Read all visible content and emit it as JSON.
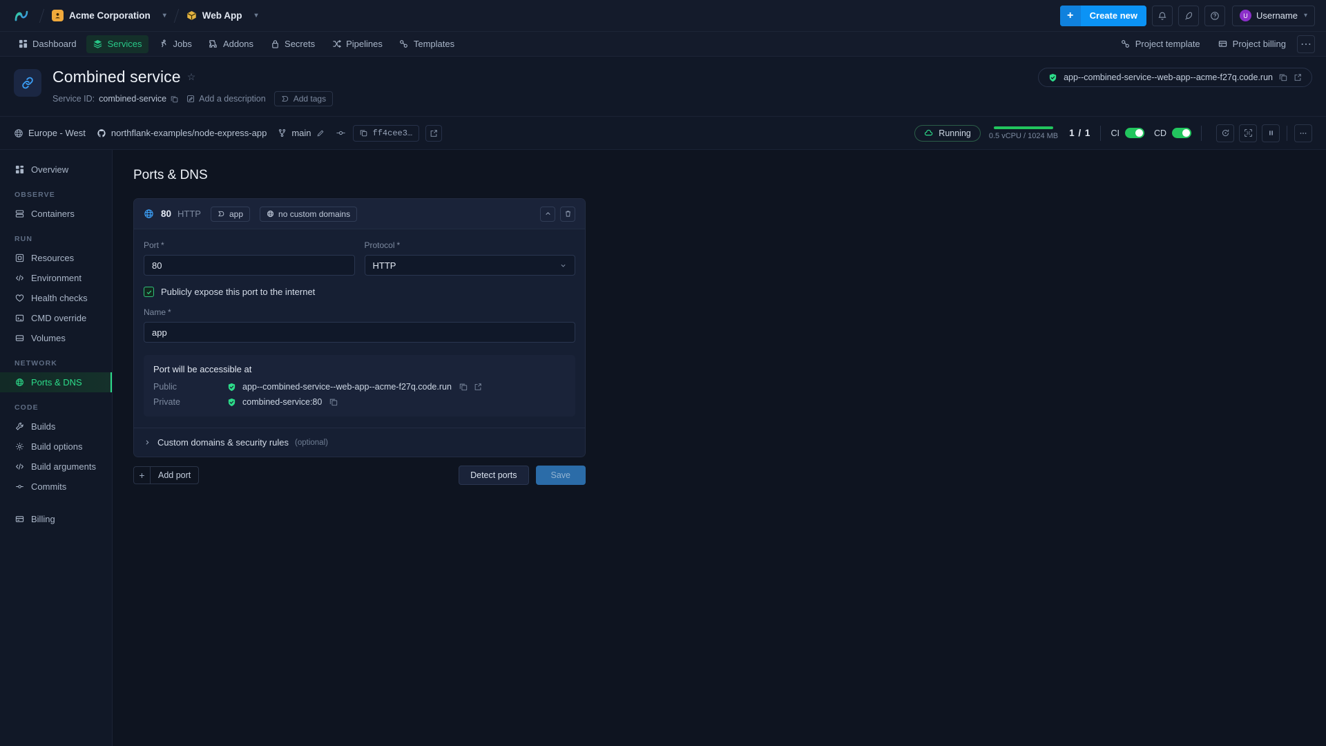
{
  "topbar": {
    "logo_icon": "northflank-logo-icon",
    "org": {
      "name": "Acme Corporation",
      "icon": "org-avatar-icon"
    },
    "project": {
      "name": "Web App",
      "icon": "project-cube-icon"
    },
    "create_new": {
      "label": "Create new",
      "plus": "+"
    },
    "icons": {
      "bell": "bell-icon",
      "rocket": "rocket-icon",
      "help": "help-circle-icon"
    },
    "user": {
      "name": "Username",
      "initial": "U"
    }
  },
  "nav": {
    "tabs": [
      {
        "label": "Dashboard",
        "icon": "grid-icon",
        "active": false
      },
      {
        "label": "Services",
        "icon": "layers-icon",
        "active": true
      },
      {
        "label": "Jobs",
        "icon": "runner-icon",
        "active": false
      },
      {
        "label": "Addons",
        "icon": "puzzle-icon",
        "active": false
      },
      {
        "label": "Secrets",
        "icon": "lock-icon",
        "active": false
      },
      {
        "label": "Pipelines",
        "icon": "shuffle-icon",
        "active": false
      },
      {
        "label": "Templates",
        "icon": "template-icon",
        "active": false
      }
    ],
    "right": [
      {
        "label": "Project template",
        "icon": "template-icon"
      },
      {
        "label": "Project billing",
        "icon": "billing-card-icon"
      }
    ],
    "more_label": "⋯"
  },
  "service": {
    "icon": "link-chain-icon",
    "title": "Combined service",
    "star_icon": "star-outline-icon",
    "id_label": "Service ID:",
    "id_value": "combined-service",
    "copy_icon": "copy-icon",
    "description_placeholder": "Add a description",
    "description_icon": "pencil-edit-icon",
    "tags_label": "Add tags",
    "tags_icon": "tag-icon",
    "url_pill": {
      "text": "app--combined-service--web-app--acme-f27q.code.run",
      "shield_icon": "shield-check-icon",
      "copy_icon": "copy-icon",
      "external_icon": "external-link-icon"
    }
  },
  "infobar": {
    "region": {
      "label": "Europe - West",
      "icon": "globe-icon"
    },
    "repo": {
      "label": "northflank-examples/node-express-app",
      "icon": "github-icon"
    },
    "branch": {
      "label": "main",
      "icon": "branch-icon",
      "edit_icon": "pencil-edit-icon"
    },
    "commit_dot_icon": "commit-dot-icon",
    "commit": {
      "label": "ff4cee3…",
      "copy_icon": "copy-icon"
    },
    "external_icon": "external-link-icon",
    "status": {
      "label": "Running",
      "icon": "cloud-icon",
      "color": "#22c55e"
    },
    "resources": {
      "text": "0.5 vCPU / 1024 MB",
      "bar_color": "#22c55e"
    },
    "instances": "1 / 1",
    "ci": {
      "label": "CI",
      "on": true
    },
    "cd": {
      "label": "CD",
      "on": true
    },
    "actions": [
      {
        "icon": "restart-icon",
        "name": "restart-button"
      },
      {
        "icon": "scale-icon",
        "name": "scale-button"
      },
      {
        "icon": "pause-icon",
        "name": "pause-button"
      },
      {
        "icon": "more-icon",
        "name": "more-button"
      }
    ]
  },
  "sidebar": {
    "top": [
      {
        "label": "Overview",
        "icon": "grid-icon",
        "active": false
      }
    ],
    "groups": [
      {
        "title": "OBSERVE",
        "items": [
          {
            "label": "Containers",
            "icon": "containers-icon",
            "active": false
          }
        ]
      },
      {
        "title": "RUN",
        "items": [
          {
            "label": "Resources",
            "icon": "resources-icon",
            "active": false
          },
          {
            "label": "Environment",
            "icon": "code-icon",
            "active": false
          },
          {
            "label": "Health checks",
            "icon": "heart-icon",
            "active": false
          },
          {
            "label": "CMD override",
            "icon": "terminal-icon",
            "active": false
          },
          {
            "label": "Volumes",
            "icon": "volume-icon",
            "active": false
          }
        ]
      },
      {
        "title": "NETWORK",
        "items": [
          {
            "label": "Ports & DNS",
            "icon": "globe-icon",
            "active": true
          }
        ]
      },
      {
        "title": "CODE",
        "items": [
          {
            "label": "Builds",
            "icon": "wrench-icon",
            "active": false
          },
          {
            "label": "Build options",
            "icon": "gear-icon",
            "active": false
          },
          {
            "label": "Build arguments",
            "icon": "code-icon",
            "active": false
          },
          {
            "label": "Commits",
            "icon": "commit-dot-icon",
            "active": false
          }
        ]
      }
    ],
    "footer": [
      {
        "label": "Billing",
        "icon": "billing-card-icon",
        "active": false
      }
    ]
  },
  "main": {
    "page_title": "Ports & DNS",
    "port_card": {
      "globe_icon": "globe-icon",
      "port_number": "80",
      "protocol_label": "HTTP",
      "chips": [
        {
          "label": "app",
          "icon": "tag-icon"
        },
        {
          "label": "no custom domains",
          "icon": "globe-icon"
        }
      ],
      "collapse_icon": "chevron-up-icon",
      "delete_icon": "trash-icon",
      "fields": {
        "port": {
          "label": "Port",
          "required": "*",
          "value": "80"
        },
        "protocol": {
          "label": "Protocol",
          "required": "*",
          "value": "HTTP",
          "chevron": "chevron-down-icon"
        },
        "name": {
          "label": "Name",
          "required": "*",
          "value": "app"
        }
      },
      "expose_checkbox": {
        "label": "Publicly expose this port to the internet",
        "checked": true,
        "check_icon": "check-icon"
      },
      "access": {
        "title": "Port will be accessible at",
        "rows": [
          {
            "key": "Public",
            "value": "app--combined-service--web-app--acme-f27q.code.run",
            "shield_icon": "shield-check-icon",
            "copy_icon": "copy-icon",
            "external_icon": "external-link-icon"
          },
          {
            "key": "Private",
            "value": "combined-service:80",
            "shield_icon": "shield-check-icon",
            "copy_icon": "copy-icon",
            "external_icon": ""
          }
        ]
      },
      "custom_domains": {
        "label": "Custom domains & security rules",
        "optional": "(optional)",
        "chevron": "chevron-right-icon"
      }
    },
    "footer": {
      "add_port": {
        "label": "Add port",
        "plus": "+"
      },
      "detect_ports": "Detect ports",
      "save": "Save"
    }
  }
}
